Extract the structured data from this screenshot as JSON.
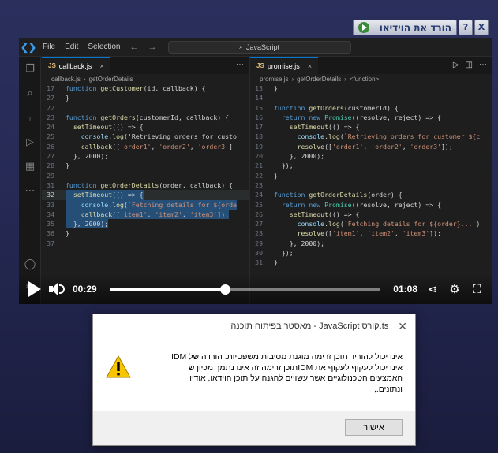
{
  "idm_bar": {
    "download_label": "הורד את הוידיאו",
    "help_label": "?",
    "close_label": "X"
  },
  "vscode": {
    "menu": [
      "File",
      "Edit",
      "Selection"
    ],
    "search": "JavaScript",
    "left_tab": {
      "filename": "callback.js",
      "crumb_file": "callback.js",
      "crumb_symbol": "getOrderDetails"
    },
    "right_tab": {
      "filename": "promise.js",
      "crumb_file": "promise.js",
      "crumb_symbol": "getOrderDetails",
      "crumb_inner": "<function>"
    },
    "left_lines": [
      {
        "n": "17",
        "text": "function getCustomer(id, callback) {"
      },
      {
        "n": "27",
        "text": "}"
      },
      {
        "n": "22",
        "text": ""
      },
      {
        "n": "23",
        "text": "function getOrders(customerId, callback) {"
      },
      {
        "n": "24",
        "text": "  setTimeout(() => {"
      },
      {
        "n": "25",
        "text": "    console.log('Retrieving orders for custo"
      },
      {
        "n": "26",
        "text": "    callback(['order1', 'order2', 'order3']"
      },
      {
        "n": "27",
        "text": "  }, 2000);"
      },
      {
        "n": "28",
        "text": "}"
      },
      {
        "n": "29",
        "text": ""
      },
      {
        "n": "31",
        "text": "function getOrderDetails(order, callback) {"
      },
      {
        "n": "32",
        "text": "  setTimeout(() => {"
      },
      {
        "n": "33",
        "text": "    console.log(`Fetching details for ${orde"
      },
      {
        "n": "34",
        "text": "    callback(['item1', 'item2', 'item3']);"
      },
      {
        "n": "35",
        "text": "  }, 2000);"
      },
      {
        "n": "36",
        "text": "}"
      },
      {
        "n": "37",
        "text": ""
      }
    ],
    "right_lines": [
      {
        "n": "13",
        "text": "}"
      },
      {
        "n": "14",
        "text": ""
      },
      {
        "n": "15",
        "text": "function getOrders(customerId) {"
      },
      {
        "n": "16",
        "text": "  return new Promise((resolve, reject) => {"
      },
      {
        "n": "17",
        "text": "    setTimeout(() => {"
      },
      {
        "n": "18",
        "text": "      console.log(`Retrieving orders for customer ${c"
      },
      {
        "n": "19",
        "text": "      resolve(['order1', 'order2', 'order3']);"
      },
      {
        "n": "20",
        "text": "    }, 2000);"
      },
      {
        "n": "21",
        "text": "  });"
      },
      {
        "n": "22",
        "text": "}"
      },
      {
        "n": "23",
        "text": ""
      },
      {
        "n": "24",
        "text": "function getOrderDetails(order) {"
      },
      {
        "n": "25",
        "text": "  return new Promise((resolve, reject) => {"
      },
      {
        "n": "26",
        "text": "    setTimeout(() => {"
      },
      {
        "n": "27",
        "text": "      console.log(`Fetching details for ${order}...`)"
      },
      {
        "n": "28",
        "text": "      resolve(['item1', 'item2', 'item3']);"
      },
      {
        "n": "29",
        "text": "    }, 2000);"
      },
      {
        "n": "30",
        "text": "  });"
      },
      {
        "n": "31",
        "text": "}"
      }
    ]
  },
  "player": {
    "current_time": "00:29",
    "duration": "01:08",
    "progress_fraction": 0.426
  },
  "dialog": {
    "title": "מאסטר בפיתוח תוכנה - JavaScript קורס.ts",
    "message_lines": [
      "אינו יכול להוריד תוכן זרימה מוגנת מסיבות משפטיות. הורדה של IDM",
      "אינו יכול לעקוף לעקוף את IDMתוכן זרימה זה אינו נתמך מכיון ש",
      "האמצעים הטכנולוגיים אשר עשויים להגנה על תוכן הוידאו, אודיו",
      "ונתונים.,"
    ],
    "ok_label": "אישור"
  }
}
